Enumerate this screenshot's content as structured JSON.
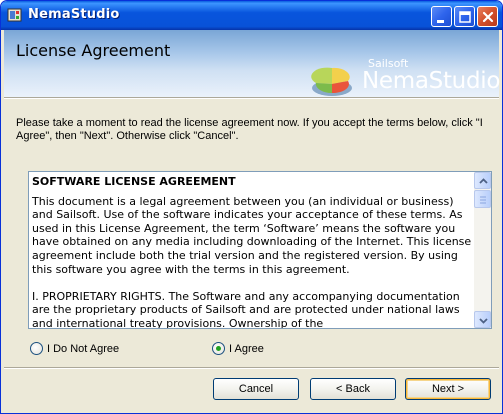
{
  "window": {
    "title": "NemaStudio"
  },
  "header": {
    "title": "License Agreement",
    "brand_small": "Sailsoft",
    "brand_big": "NemaStudio"
  },
  "intro_text": "Please take a moment to read the license agreement now. If you accept the terms below, click \"I Agree\", then \"Next\". Otherwise click \"Cancel\".",
  "license": {
    "heading": "SOFTWARE LICENSE AGREEMENT",
    "paragraphs": [
      "This document is a legal agreement between you (an individual or business) and Sailsoft. Use of the software indicates your acceptance of these terms. As used in this License Agreement, the term ‘Software’ means the software you have obtained on any media including downloading of the Internet.  This license agreement include both the trial version and the registered version. By using this software you agree with the terms in this agreement.",
      "I. PROPRIETARY RIGHTS. The Software and any accompanying documentation are the proprietary products of Sailsoft and are protected under national laws and international treaty provisions. Ownership of the"
    ]
  },
  "radios": {
    "disagree_label": "I Do Not Agree",
    "agree_label": "I Agree",
    "selected": "agree"
  },
  "buttons": {
    "cancel": "Cancel",
    "back": "< Back",
    "next": "Next >"
  },
  "colors": {
    "title_bar": "#0855dd",
    "dialog_bg": "#ece9d8",
    "radio_checked": "#21a121"
  }
}
